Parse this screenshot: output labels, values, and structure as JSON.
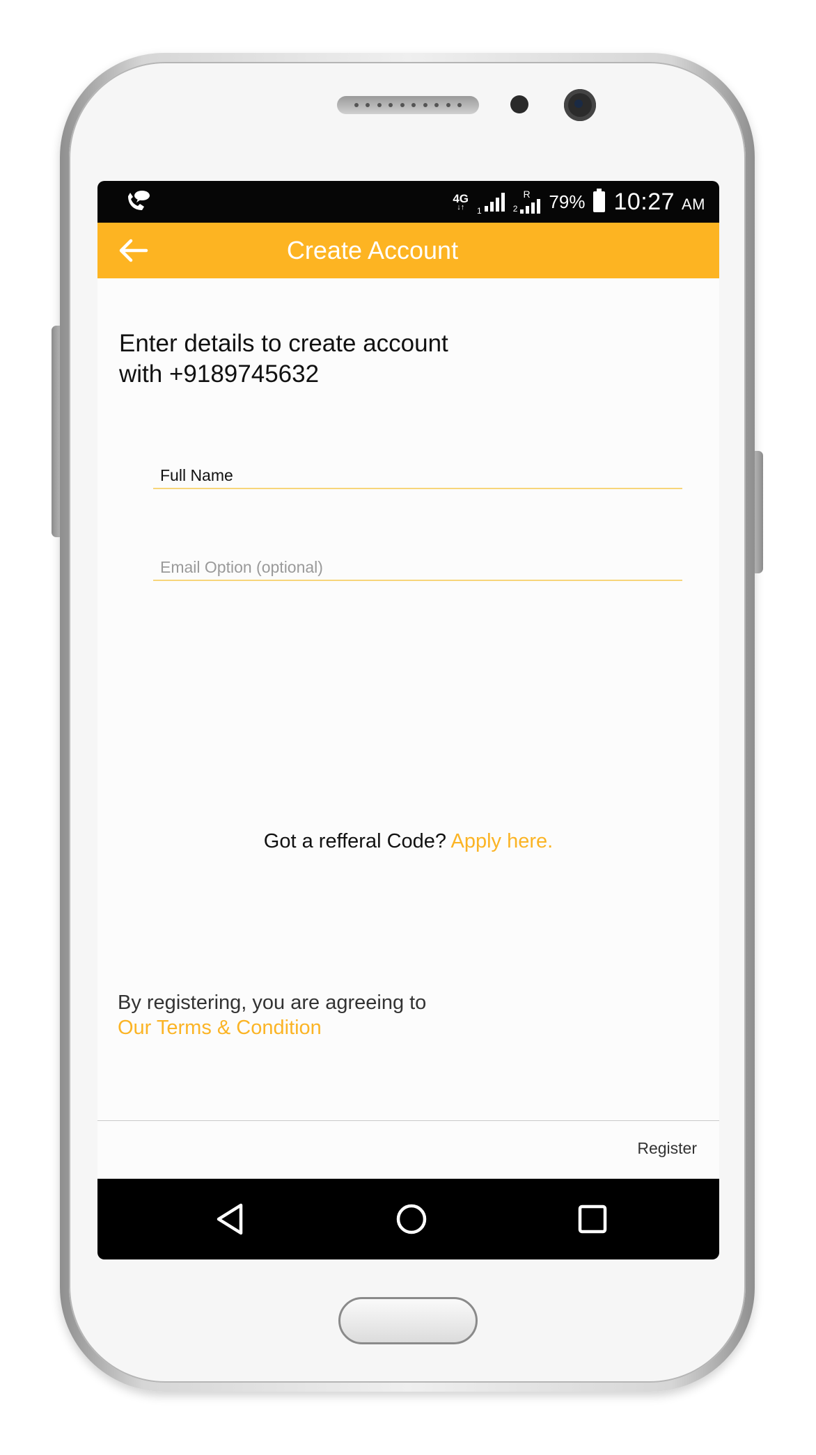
{
  "status_bar": {
    "network_type": "4G",
    "sim1_label": "1",
    "sim2_label": "2",
    "roaming_label": "R",
    "battery_percent": "79%",
    "time": "10:27",
    "time_suffix": "AM",
    "icons": [
      "call-notification-icon",
      "signal-icon",
      "battery-icon"
    ]
  },
  "app_bar": {
    "title": "Create Account",
    "back_icon": "arrow-left-icon",
    "background_color": "#fdb422"
  },
  "intro": {
    "line1": "Enter details to create account",
    "line2": "with +9189745632"
  },
  "form": {
    "full_name_placeholder": "Full Name",
    "email_placeholder": "Email Option (optional)"
  },
  "referral": {
    "prompt": "Got a refferal Code? ",
    "link": "Apply here."
  },
  "terms": {
    "text": "By registering, you are agreeing to",
    "link": "Our Terms & Condition"
  },
  "footer": {
    "register_label": "Register"
  },
  "nav_bar": {
    "icons": [
      "nav-back-icon",
      "nav-home-icon",
      "nav-recent-apps-icon"
    ]
  },
  "colors": {
    "accent": "#fbb425"
  }
}
